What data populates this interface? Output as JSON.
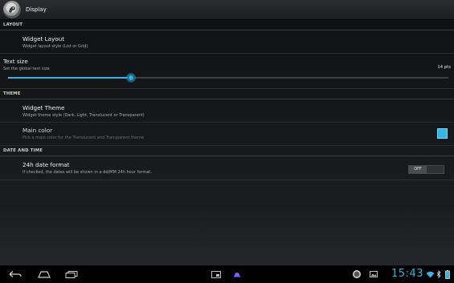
{
  "action_bar": {
    "title": "Display",
    "icon": "app-logo-icon"
  },
  "sections": {
    "layout": "LAYOUT",
    "theme": "THEME",
    "date_time": "DATE AND TIME"
  },
  "widget_layout": {
    "title": "Widget Layout",
    "summary": "Widget layout style (List or Grid)"
  },
  "text_size": {
    "title": "Text size",
    "summary": "Set the global text size",
    "value_label": "14 pts",
    "slider_fraction": 0.28
  },
  "widget_theme": {
    "title": "Widget Theme",
    "summary": "Widget theme style (Dark, Light, Translucent or Transparent)"
  },
  "main_color": {
    "title": "Main color",
    "summary": "Pick a main color for the Translucent and Transparent theme",
    "color": "#33b5e5"
  },
  "date_format": {
    "title": "24h date format",
    "summary": "If checked, the dates will be shown in a dd/MM 24h hour format.",
    "toggle_label": "OFF"
  },
  "nav_bar": {
    "back_icon": "back-icon",
    "home_icon": "home-icon",
    "recents_icon": "recent-apps-icon",
    "screenshot_icon": "screenshot-icon",
    "app_icon": "notification-app-icon",
    "badge_icon": "notification-badge-icon",
    "gallery_icon": "notification-image-icon",
    "time": "15:43",
    "wifi_icon": "wifi-icon",
    "bluetooth_icon": "bluetooth-icon",
    "battery_icon": "battery-icon"
  },
  "colors": {
    "accent": "#33b5e5",
    "background": "#111214",
    "nav_background": "#000000"
  }
}
